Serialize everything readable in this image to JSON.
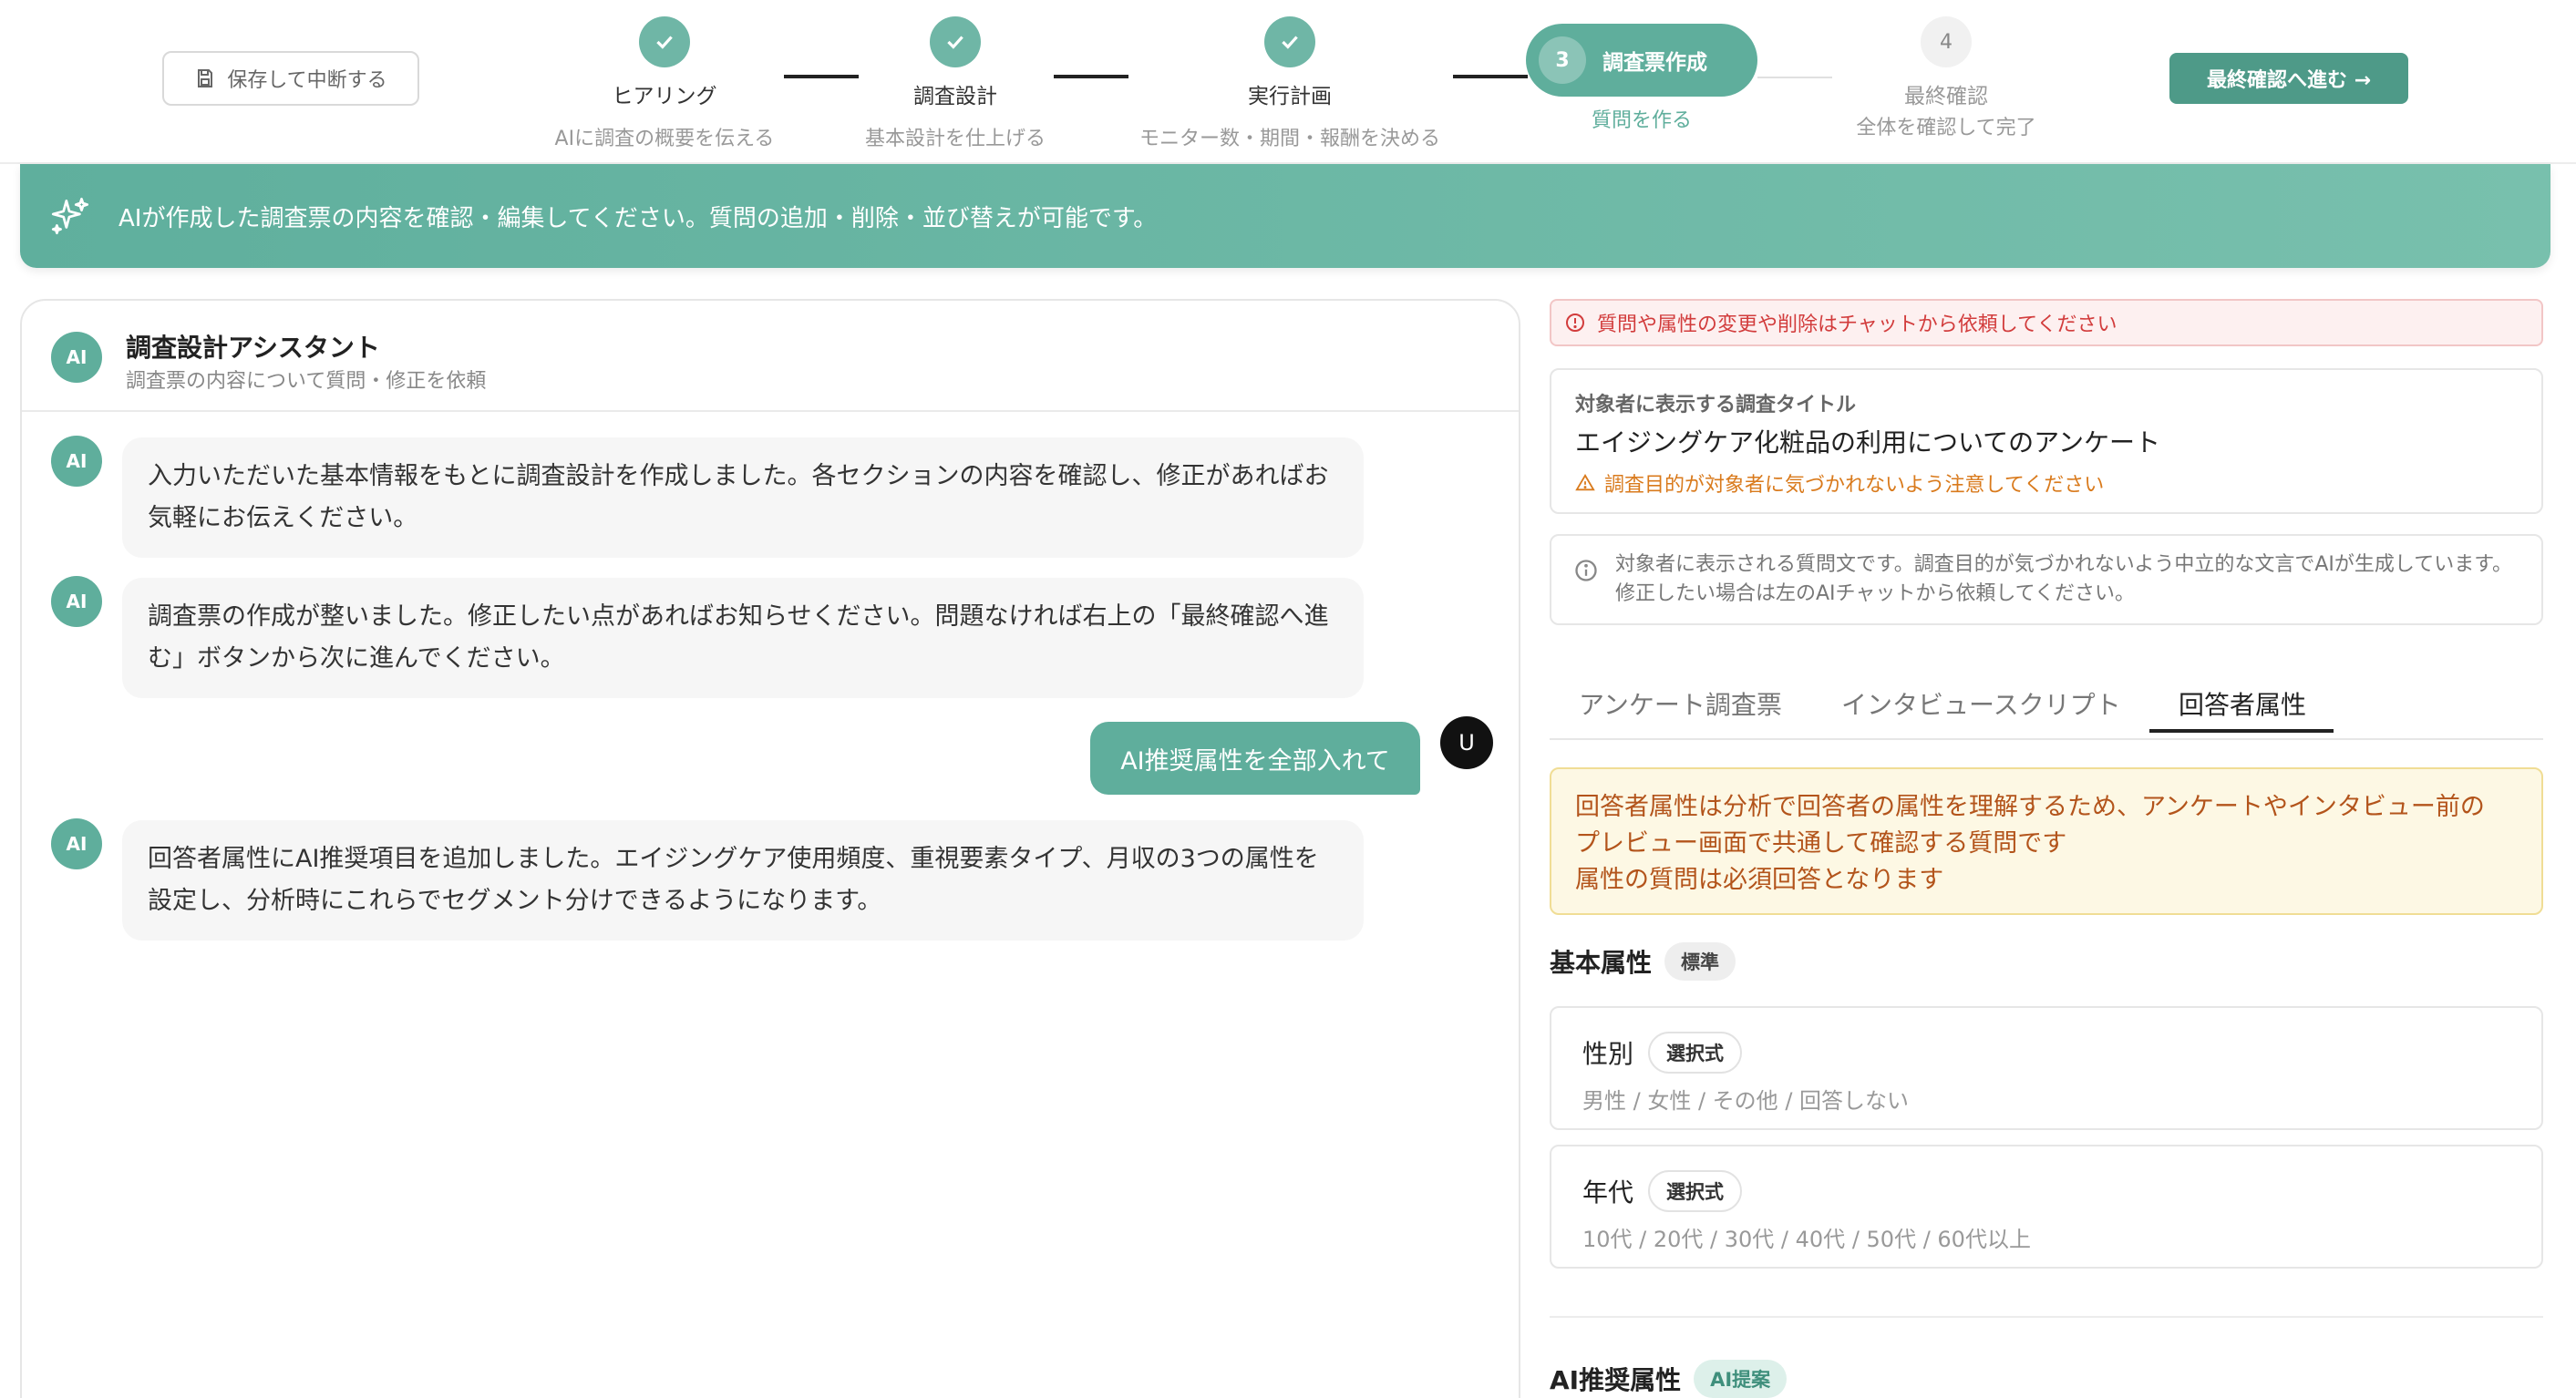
{
  "header": {
    "save_label": "保存して中断する",
    "next_label": "最終確認へ進む →",
    "steps": [
      {
        "title": "ヒアリング",
        "sub": "AIに調査の概要を伝える"
      },
      {
        "title": "調査設計",
        "sub": "基本設計を仕上げる"
      },
      {
        "title": "実行計画",
        "sub": "モニター数・期間・報酬を決める"
      },
      {
        "num": "3",
        "title": "調査票作成",
        "sub": "質問を作る"
      },
      {
        "num": "4",
        "title": "最終確認",
        "sub": "全体を確認して完了"
      }
    ]
  },
  "banner": {
    "text": "AIが作成した調査票の内容を確認・編集してください。質問の追加・削除・並び替えが可能です。"
  },
  "chat": {
    "avatar": "AI",
    "title": "調査設計アシスタント",
    "subtitle": "調査票の内容について質問・修正を依頼",
    "messages": [
      {
        "role": "ai",
        "text": "入力いただいた基本情報をもとに調査設計を作成しました。各セクションの内容を確認し、修正があればお気軽にお伝えください。"
      },
      {
        "role": "ai",
        "text": "調査票の作成が整いました。修正したい点があればお知らせください。問題なければ右上の「最終確認へ進む」ボタンから次に進んでください。"
      },
      {
        "role": "user",
        "avatar": "U",
        "text": "AI推奨属性を全部入れて"
      },
      {
        "role": "ai",
        "text": "回答者属性にAI推奨項目を追加しました。エイジングケア使用頻度、重視要素タイプ、月収の3つの属性を設定し、分析時にこれらでセグメント分けできるようになります。"
      }
    ]
  },
  "right": {
    "warning": "質問や属性の変更や削除はチャットから依頼してください",
    "title_label": "対象者に表示する調査タイトル",
    "title_value": "エイジングケア化粧品の利用についてのアンケート",
    "title_caution": "調査目的が対象者に気づかれないよう注意してください",
    "info": "対象者に表示される質問文です。調査目的が気づかれないよう中立的な文言でAIが生成しています。修正したい場合は左のAIチャットから依頼してください。",
    "tabs": [
      "アンケート調査票",
      "インタビュースクリプト",
      "回答者属性"
    ],
    "active_tab": "回答者属性",
    "notice_lines": [
      "回答者属性は分析で回答者の属性を理解するため、アンケートやインタビュー前の",
      "プレビュー画面で共通して確認する質問です",
      "属性の質問は必須回答となります"
    ],
    "basic_section": {
      "title": "基本属性",
      "chip": "標準"
    },
    "attributes": [
      {
        "name": "性別",
        "type": "選択式",
        "options": "男性 / 女性 / その他 / 回答しない"
      },
      {
        "name": "年代",
        "type": "選択式",
        "options": "10代 / 20代 / 30代 / 40代 / 50代 / 60代以上"
      }
    ],
    "ai_section": {
      "title": "AI推奨属性",
      "chip": "AI提案"
    }
  },
  "colors": {
    "accent": "#5fae9c",
    "accent_dark": "#4e9a88",
    "warning_red": "#d23c3c",
    "caution_orange": "#d97a1c"
  }
}
